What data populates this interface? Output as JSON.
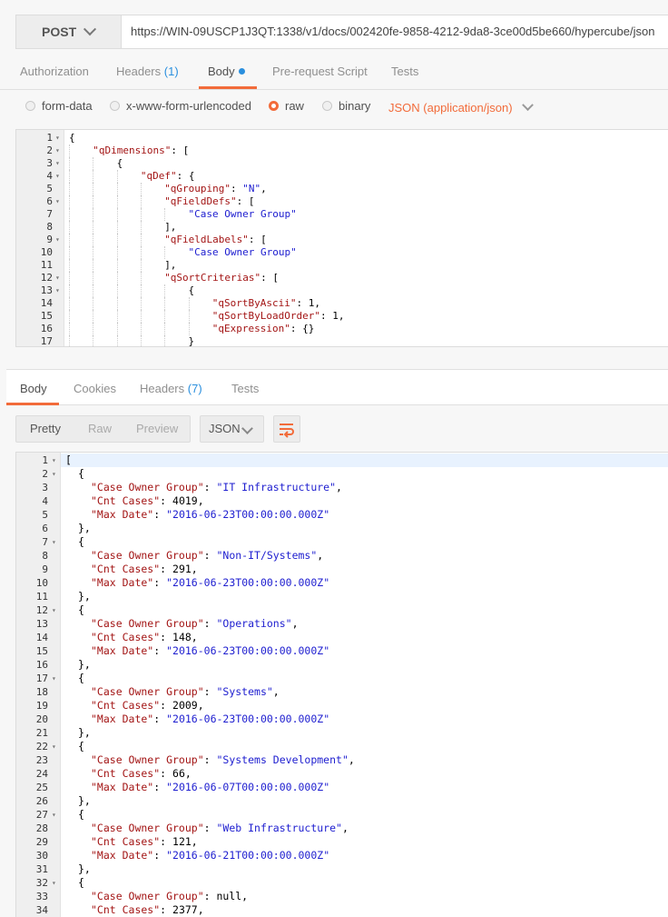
{
  "request": {
    "method": "POST",
    "url": "https://WIN-09USCP1J3QT:1338/v1/docs/002420fe-9858-4212-9da8-3ce00d5be660/hypercube/json",
    "tabs": [
      {
        "label": "Authorization"
      },
      {
        "label": "Headers",
        "count": "(1)"
      },
      {
        "label": "Body",
        "active": true
      },
      {
        "label": "Pre-request Script"
      },
      {
        "label": "Tests"
      }
    ],
    "body_types": [
      "form-data",
      "x-www-form-urlencoded",
      "raw",
      "binary"
    ],
    "body_type_selected": "raw",
    "content_type": "JSON (application/json)",
    "body_lines": [
      {
        "n": "1",
        "fold": true,
        "indent": 0,
        "parts": [
          [
            "n",
            "{"
          ]
        ]
      },
      {
        "n": "2",
        "fold": true,
        "indent": 1,
        "parts": [
          [
            "k",
            "\"qDimensions\""
          ],
          [
            "n",
            ": ["
          ]
        ]
      },
      {
        "n": "3",
        "fold": true,
        "indent": 2,
        "parts": [
          [
            "n",
            "{"
          ]
        ]
      },
      {
        "n": "4",
        "fold": true,
        "indent": 3,
        "parts": [
          [
            "k",
            "\"qDef\""
          ],
          [
            "n",
            ": {"
          ]
        ]
      },
      {
        "n": "5",
        "fold": false,
        "indent": 4,
        "parts": [
          [
            "k",
            "\"qGrouping\""
          ],
          [
            "n",
            ": "
          ],
          [
            "s",
            "\"N\""
          ],
          [
            "n",
            ","
          ]
        ]
      },
      {
        "n": "6",
        "fold": true,
        "indent": 4,
        "parts": [
          [
            "k",
            "\"qFieldDefs\""
          ],
          [
            "n",
            ": ["
          ]
        ]
      },
      {
        "n": "7",
        "fold": false,
        "indent": 5,
        "parts": [
          [
            "s",
            "\"Case Owner Group\""
          ]
        ]
      },
      {
        "n": "8",
        "fold": false,
        "indent": 4,
        "parts": [
          [
            "n",
            "],"
          ]
        ]
      },
      {
        "n": "9",
        "fold": true,
        "indent": 4,
        "parts": [
          [
            "k",
            "\"qFieldLabels\""
          ],
          [
            "n",
            ": ["
          ]
        ]
      },
      {
        "n": "10",
        "fold": false,
        "indent": 5,
        "parts": [
          [
            "s",
            "\"Case Owner Group\""
          ]
        ]
      },
      {
        "n": "11",
        "fold": false,
        "indent": 4,
        "parts": [
          [
            "n",
            "],"
          ]
        ]
      },
      {
        "n": "12",
        "fold": true,
        "indent": 4,
        "parts": [
          [
            "k",
            "\"qSortCriterias\""
          ],
          [
            "n",
            ": ["
          ]
        ]
      },
      {
        "n": "13",
        "fold": true,
        "indent": 5,
        "parts": [
          [
            "n",
            "{"
          ]
        ]
      },
      {
        "n": "14",
        "fold": false,
        "indent": 6,
        "parts": [
          [
            "k",
            "\"qSortByAscii\""
          ],
          [
            "n",
            ": 1,"
          ]
        ]
      },
      {
        "n": "15",
        "fold": false,
        "indent": 6,
        "parts": [
          [
            "k",
            "\"qSortByLoadOrder\""
          ],
          [
            "n",
            ": 1,"
          ]
        ]
      },
      {
        "n": "16",
        "fold": false,
        "indent": 6,
        "parts": [
          [
            "k",
            "\"qExpression\""
          ],
          [
            "n",
            ": {}"
          ]
        ]
      },
      {
        "n": "17",
        "fold": false,
        "indent": 5,
        "parts": [
          [
            "n",
            "}"
          ]
        ]
      }
    ]
  },
  "response": {
    "tabs": [
      {
        "label": "Body",
        "active": true
      },
      {
        "label": "Cookies"
      },
      {
        "label": "Headers",
        "count": "(7)"
      },
      {
        "label": "Tests"
      }
    ],
    "formats": [
      "Pretty",
      "Raw",
      "Preview"
    ],
    "format_selected": "Pretty",
    "language": "JSON",
    "body_lines": [
      {
        "n": "1",
        "fold": true,
        "indent": 0,
        "parts": [
          [
            "n",
            "["
          ]
        ]
      },
      {
        "n": "2",
        "fold": true,
        "indent": 1,
        "parts": [
          [
            "n",
            "{"
          ]
        ]
      },
      {
        "n": "3",
        "fold": false,
        "indent": 2,
        "parts": [
          [
            "k",
            "\"Case Owner Group\""
          ],
          [
            "n",
            ": "
          ],
          [
            "s",
            "\"IT Infrastructure\""
          ],
          [
            "n",
            ","
          ]
        ]
      },
      {
        "n": "4",
        "fold": false,
        "indent": 2,
        "parts": [
          [
            "k",
            "\"Cnt Cases\""
          ],
          [
            "n",
            ": 4019,"
          ]
        ]
      },
      {
        "n": "5",
        "fold": false,
        "indent": 2,
        "parts": [
          [
            "k",
            "\"Max Date\""
          ],
          [
            "n",
            ": "
          ],
          [
            "s",
            "\"2016-06-23T00:00:00.000Z\""
          ]
        ]
      },
      {
        "n": "6",
        "fold": false,
        "indent": 1,
        "parts": [
          [
            "n",
            "},"
          ]
        ]
      },
      {
        "n": "7",
        "fold": true,
        "indent": 1,
        "parts": [
          [
            "n",
            "{"
          ]
        ]
      },
      {
        "n": "8",
        "fold": false,
        "indent": 2,
        "parts": [
          [
            "k",
            "\"Case Owner Group\""
          ],
          [
            "n",
            ": "
          ],
          [
            "s",
            "\"Non-IT/Systems\""
          ],
          [
            "n",
            ","
          ]
        ]
      },
      {
        "n": "9",
        "fold": false,
        "indent": 2,
        "parts": [
          [
            "k",
            "\"Cnt Cases\""
          ],
          [
            "n",
            ": 291,"
          ]
        ]
      },
      {
        "n": "10",
        "fold": false,
        "indent": 2,
        "parts": [
          [
            "k",
            "\"Max Date\""
          ],
          [
            "n",
            ": "
          ],
          [
            "s",
            "\"2016-06-23T00:00:00.000Z\""
          ]
        ]
      },
      {
        "n": "11",
        "fold": false,
        "indent": 1,
        "parts": [
          [
            "n",
            "},"
          ]
        ]
      },
      {
        "n": "12",
        "fold": true,
        "indent": 1,
        "parts": [
          [
            "n",
            "{"
          ]
        ]
      },
      {
        "n": "13",
        "fold": false,
        "indent": 2,
        "parts": [
          [
            "k",
            "\"Case Owner Group\""
          ],
          [
            "n",
            ": "
          ],
          [
            "s",
            "\"Operations\""
          ],
          [
            "n",
            ","
          ]
        ]
      },
      {
        "n": "14",
        "fold": false,
        "indent": 2,
        "parts": [
          [
            "k",
            "\"Cnt Cases\""
          ],
          [
            "n",
            ": 148,"
          ]
        ]
      },
      {
        "n": "15",
        "fold": false,
        "indent": 2,
        "parts": [
          [
            "k",
            "\"Max Date\""
          ],
          [
            "n",
            ": "
          ],
          [
            "s",
            "\"2016-06-23T00:00:00.000Z\""
          ]
        ]
      },
      {
        "n": "16",
        "fold": false,
        "indent": 1,
        "parts": [
          [
            "n",
            "},"
          ]
        ]
      },
      {
        "n": "17",
        "fold": true,
        "indent": 1,
        "parts": [
          [
            "n",
            "{"
          ]
        ]
      },
      {
        "n": "18",
        "fold": false,
        "indent": 2,
        "parts": [
          [
            "k",
            "\"Case Owner Group\""
          ],
          [
            "n",
            ": "
          ],
          [
            "s",
            "\"Systems\""
          ],
          [
            "n",
            ","
          ]
        ]
      },
      {
        "n": "19",
        "fold": false,
        "indent": 2,
        "parts": [
          [
            "k",
            "\"Cnt Cases\""
          ],
          [
            "n",
            ": 2009,"
          ]
        ]
      },
      {
        "n": "20",
        "fold": false,
        "indent": 2,
        "parts": [
          [
            "k",
            "\"Max Date\""
          ],
          [
            "n",
            ": "
          ],
          [
            "s",
            "\"2016-06-23T00:00:00.000Z\""
          ]
        ]
      },
      {
        "n": "21",
        "fold": false,
        "indent": 1,
        "parts": [
          [
            "n",
            "},"
          ]
        ]
      },
      {
        "n": "22",
        "fold": true,
        "indent": 1,
        "parts": [
          [
            "n",
            "{"
          ]
        ]
      },
      {
        "n": "23",
        "fold": false,
        "indent": 2,
        "parts": [
          [
            "k",
            "\"Case Owner Group\""
          ],
          [
            "n",
            ": "
          ],
          [
            "s",
            "\"Systems Development\""
          ],
          [
            "n",
            ","
          ]
        ]
      },
      {
        "n": "24",
        "fold": false,
        "indent": 2,
        "parts": [
          [
            "k",
            "\"Cnt Cases\""
          ],
          [
            "n",
            ": 66,"
          ]
        ]
      },
      {
        "n": "25",
        "fold": false,
        "indent": 2,
        "parts": [
          [
            "k",
            "\"Max Date\""
          ],
          [
            "n",
            ": "
          ],
          [
            "s",
            "\"2016-06-07T00:00:00.000Z\""
          ]
        ]
      },
      {
        "n": "26",
        "fold": false,
        "indent": 1,
        "parts": [
          [
            "n",
            "},"
          ]
        ]
      },
      {
        "n": "27",
        "fold": true,
        "indent": 1,
        "parts": [
          [
            "n",
            "{"
          ]
        ]
      },
      {
        "n": "28",
        "fold": false,
        "indent": 2,
        "parts": [
          [
            "k",
            "\"Case Owner Group\""
          ],
          [
            "n",
            ": "
          ],
          [
            "s",
            "\"Web Infrastructure\""
          ],
          [
            "n",
            ","
          ]
        ]
      },
      {
        "n": "29",
        "fold": false,
        "indent": 2,
        "parts": [
          [
            "k",
            "\"Cnt Cases\""
          ],
          [
            "n",
            ": 121,"
          ]
        ]
      },
      {
        "n": "30",
        "fold": false,
        "indent": 2,
        "parts": [
          [
            "k",
            "\"Max Date\""
          ],
          [
            "n",
            ": "
          ],
          [
            "s",
            "\"2016-06-21T00:00:00.000Z\""
          ]
        ]
      },
      {
        "n": "31",
        "fold": false,
        "indent": 1,
        "parts": [
          [
            "n",
            "},"
          ]
        ]
      },
      {
        "n": "32",
        "fold": true,
        "indent": 1,
        "parts": [
          [
            "n",
            "{"
          ]
        ]
      },
      {
        "n": "33",
        "fold": false,
        "indent": 2,
        "parts": [
          [
            "k",
            "\"Case Owner Group\""
          ],
          [
            "n",
            ": null,"
          ]
        ]
      },
      {
        "n": "34",
        "fold": false,
        "indent": 2,
        "parts": [
          [
            "k",
            "\"Cnt Cases\""
          ],
          [
            "n",
            ": 2377,"
          ]
        ]
      }
    ]
  },
  "colors": {
    "accent": "#f26b3a",
    "count_blue": "#2a8fde",
    "json_key": "#a31515",
    "json_string": "#2020d0"
  },
  "icons": {
    "method_dropdown": "chevron-down-icon",
    "content_type_dropdown": "chevron-down-icon",
    "wrap": "wrap-lines-icon"
  }
}
